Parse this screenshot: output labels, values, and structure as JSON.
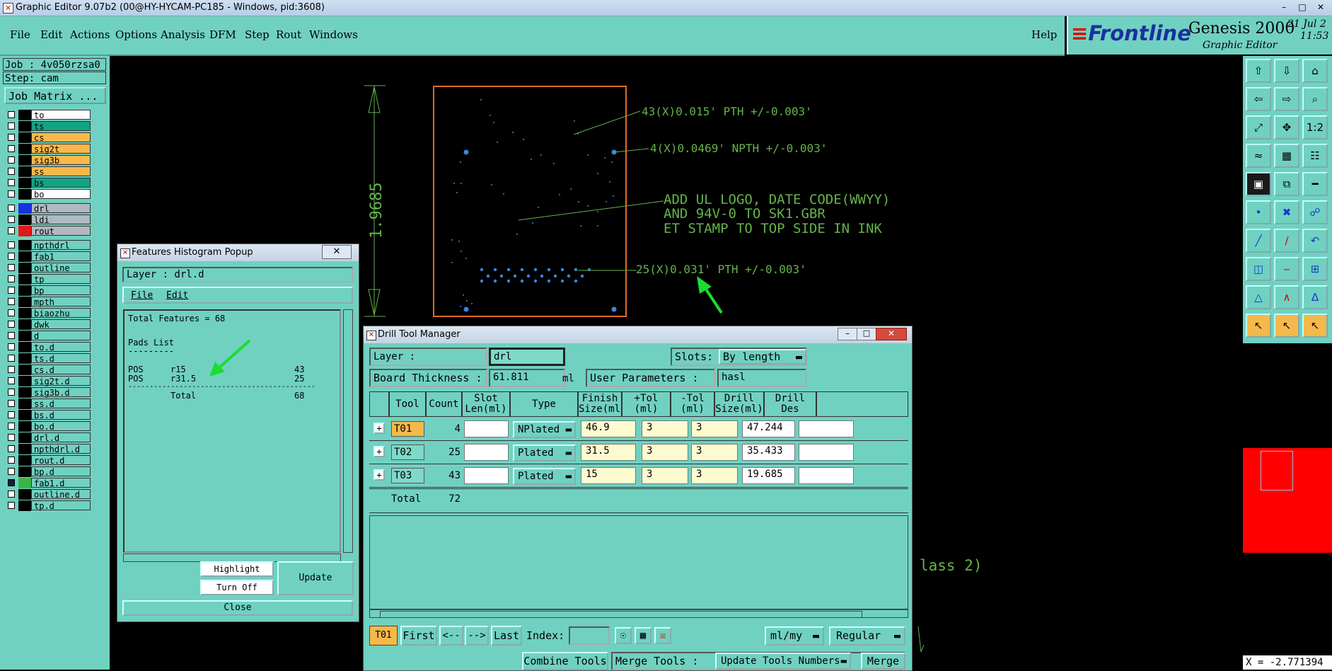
{
  "window_title": "Graphic Editor 9.07b2 (00@HY-HYCAM-PC185 - Windows, pid:3608)",
  "menu": [
    "File",
    "Edit",
    "Actions",
    "Options",
    "Analysis",
    "DFM",
    "Step",
    "Rout",
    "Windows"
  ],
  "help_label": "Help",
  "brand": {
    "logo": "Frontline",
    "product": "Genesis 2000",
    "subtitle": "Graphic Editor",
    "date": "21 Jul 2",
    "time": "11:53"
  },
  "job": {
    "job_label": "Job : 4v050rzsa0",
    "step_label": "Step: cam",
    "matrix_button": "Job Matrix ..."
  },
  "layers": [
    {
      "name": "to",
      "color": "#ffffff",
      "checked": false
    },
    {
      "name": "ts",
      "color": "#13a383",
      "checked": false
    },
    {
      "name": "cs",
      "color": "#f8b84a",
      "checked": false
    },
    {
      "name": "sig2t",
      "color": "#f8b84a",
      "checked": false
    },
    {
      "name": "sig3b",
      "color": "#f8b84a",
      "checked": false
    },
    {
      "name": "ss",
      "color": "#f8b84a",
      "checked": false
    },
    {
      "name": "bs",
      "color": "#13a383",
      "checked": false
    },
    {
      "name": "bo",
      "color": "#ffffff",
      "checked": false
    },
    {
      "name": "drl",
      "color": "#b0b8c0",
      "checked": false,
      "swatch": "#1632e0"
    },
    {
      "name": "ldi",
      "color": "#b0b8c0",
      "checked": false
    },
    {
      "name": "rout",
      "color": "#b0b8c0",
      "checked": false,
      "swatch": "#e01818"
    },
    {
      "name": "npthdrl",
      "color": "#70d1c1",
      "checked": false
    },
    {
      "name": "fab1",
      "color": "#70d1c1",
      "checked": false
    },
    {
      "name": "outline",
      "color": "#70d1c1",
      "checked": false
    },
    {
      "name": "tp",
      "color": "#70d1c1",
      "checked": false
    },
    {
      "name": "bp",
      "color": "#70d1c1",
      "checked": false
    },
    {
      "name": "mpth",
      "color": "#70d1c1",
      "checked": false
    },
    {
      "name": "biaozhu",
      "color": "#70d1c1",
      "checked": false
    },
    {
      "name": "dwk",
      "color": "#70d1c1",
      "checked": false
    },
    {
      "name": "d",
      "color": "#70d1c1",
      "checked": false
    },
    {
      "name": "to.d",
      "color": "#70d1c1",
      "checked": false
    },
    {
      "name": "ts.d",
      "color": "#70d1c1",
      "checked": false
    },
    {
      "name": "cs.d",
      "color": "#70d1c1",
      "checked": false
    },
    {
      "name": "sig2t.d",
      "color": "#70d1c1",
      "checked": false
    },
    {
      "name": "sig3b.d",
      "color": "#70d1c1",
      "checked": false
    },
    {
      "name": "ss.d",
      "color": "#70d1c1",
      "checked": false
    },
    {
      "name": "bs.d",
      "color": "#70d1c1",
      "checked": false
    },
    {
      "name": "bo.d",
      "color": "#70d1c1",
      "checked": false
    },
    {
      "name": "drl.d",
      "color": "#70d1c1",
      "checked": false
    },
    {
      "name": "npthdrl.d",
      "color": "#70d1c1",
      "checked": false
    },
    {
      "name": "rout.d",
      "color": "#70d1c1",
      "checked": false
    },
    {
      "name": "bp.d",
      "color": "#70d1c1",
      "checked": false
    },
    {
      "name": "fab1.d",
      "color": "#70d1c1",
      "checked": true,
      "swatch": "#39b54a"
    },
    {
      "name": "outline.d",
      "color": "#70d1c1",
      "checked": false
    },
    {
      "name": "tp.d",
      "color": "#70d1c1",
      "checked": false
    }
  ],
  "canvas": {
    "dimension": "1.9685",
    "note_43": "43(X)0.015' PTH +/-0.003'",
    "note_4": "4(X)0.0469' NPTH +/-0.003'",
    "note_logo_1": "ADD UL LOGO, DATE CODE(WWYY)",
    "note_logo_2": "AND 94V-0 TO SK1.GBR",
    "note_logo_3": "ET STAMP TO TOP SIDE IN INK",
    "note_25": "25(X)0.031' PTH +/-0.003'",
    "note_class": "lass 2)"
  },
  "coord": "X = -2.771394",
  "histogram": {
    "title": "Features Histogram Popup",
    "layer": "Layer :  drl.d",
    "menu_file": "File",
    "menu_edit": "Edit",
    "total_features": "Total Features = 68",
    "pads_list": "Pads List",
    "underline": "---------",
    "rows": [
      {
        "pol": "POS",
        "sym": "r15",
        "count": "43"
      },
      {
        "pol": "POS",
        "sym": "r31.5",
        "count": "25"
      }
    ],
    "rule": "--------------------------------------------",
    "total_label": "Total",
    "total_count": "68",
    "highlight": "Highlight",
    "turn_off": "Turn Off",
    "update": "Update",
    "close": "Close"
  },
  "drill": {
    "title": "Drill Tool Manager",
    "layer_label": "Layer           :",
    "layer_value": "drl",
    "slots_label": "Slots:",
    "slots_value": "By length",
    "thickness_label": "Board Thickness :",
    "thickness_value": "61.811",
    "thickness_unit": "ml",
    "userparams_label": "User Parameters :",
    "userparams_value": "hasl",
    "headers": [
      {
        "l1": "Tool",
        "l2": ""
      },
      {
        "l1": "Count",
        "l2": ""
      },
      {
        "l1": "Slot",
        "l2": "Len(ml)"
      },
      {
        "l1": "Type",
        "l2": ""
      },
      {
        "l1": "Finish",
        "l2": "Size(ml)"
      },
      {
        "l1": "+Tol",
        "l2": "(ml)"
      },
      {
        "l1": "-Tol",
        "l2": "(ml)"
      },
      {
        "l1": "Drill",
        "l2": "Size(ml)"
      },
      {
        "l1": "Drill",
        "l2": "Des"
      }
    ],
    "rows": [
      {
        "tool": "T01",
        "count": "4",
        "type": "NPlated",
        "finish": "46.9",
        "ptol": "3",
        "mtol": "3",
        "drill": "47.244"
      },
      {
        "tool": "T02",
        "count": "25",
        "type": "Plated",
        "finish": "31.5",
        "ptol": "3",
        "mtol": "3",
        "drill": "35.433"
      },
      {
        "tool": "T03",
        "count": "43",
        "type": "Plated",
        "finish": "15",
        "ptol": "3",
        "mtol": "3",
        "drill": "19.685"
      }
    ],
    "total_label": "Total",
    "total_count": "72",
    "current_tool": "T01",
    "first": "First",
    "prev": "<--",
    "next": "-->",
    "last": "Last",
    "index_label": "Index:",
    "units": "ml/my",
    "mode": "Regular",
    "combine": "Combine Tools",
    "merge_label": "Merge Tools :",
    "update_numbers": "Update Tools Numbers",
    "merge": "Merge"
  }
}
